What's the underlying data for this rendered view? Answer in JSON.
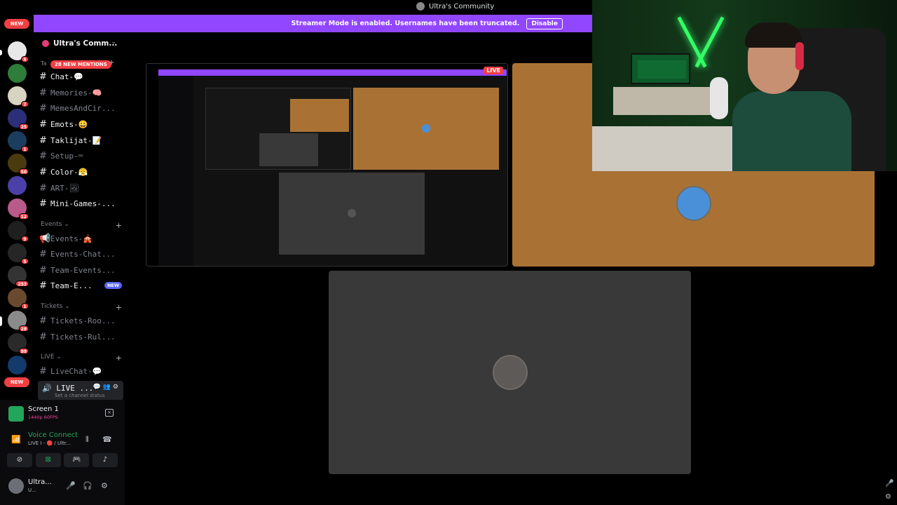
{
  "window": {
    "title": "Ultra's Community"
  },
  "banner": {
    "message": "Streamer Mode is enabled. Usernames have been truncated.",
    "disable_label": "Disable"
  },
  "rail": {
    "new_top": "NEW",
    "new_bottom": "NEW",
    "badges": [
      "5",
      "7",
      "25",
      "1",
      "50",
      "12",
      "9",
      "5",
      "253",
      "1",
      "28",
      "99"
    ]
  },
  "guild": {
    "name": "Ultra's Comm...",
    "mentions": "28 NEW MENTIONS",
    "category_peek": "Ta"
  },
  "channels": {
    "main": [
      {
        "name": "Chat-💬",
        "unread": true
      },
      {
        "name": "Memories-🧠",
        "unread": false
      },
      {
        "name": "MemesAndCir...",
        "unread": false
      },
      {
        "name": "Emots-😀",
        "unread": true
      },
      {
        "name": "Taklijat-📝",
        "unread": true
      },
      {
        "name": "Setup-⌨",
        "unread": false
      },
      {
        "name": "Color-😤",
        "unread": true
      },
      {
        "name": "ART-🖼",
        "unread": false
      },
      {
        "name": "Mini-Games-...",
        "unread": true
      }
    ],
    "events_category": "Events",
    "events": [
      {
        "name": "Events-🎪",
        "unread": false
      },
      {
        "name": "Events-Chat...",
        "unread": false
      },
      {
        "name": "Team-Events...",
        "unread": false
      },
      {
        "name": "Team-E...",
        "unread": true,
        "badge": "NEW"
      }
    ],
    "tickets_category": "Tickets",
    "tickets": [
      {
        "name": "Tickets-Roo...",
        "unread": false
      },
      {
        "name": "Tickets-Rul...",
        "unread": false
      }
    ],
    "live_category": "LIVE",
    "live": [
      {
        "name": "LiveChat-💬",
        "unread": false
      }
    ],
    "voice_channel": {
      "name": "LIVE ...",
      "status": "Set a channel status"
    }
  },
  "panel": {
    "screen_title": "Screen 1",
    "screen_sub": "1440p 60FPS",
    "voice_title": "Voice Connected",
    "voice_sub": "LIVE I - 🔴 / Ultr...",
    "user_name": "Ultra...",
    "user_sub": "U..."
  },
  "stage": {
    "live_label": "LIVE"
  },
  "colors": {
    "brand": "#9146ff",
    "danger": "#f23f43",
    "online": "#23a55a",
    "blurple": "#5865f2",
    "tile_orange": "#a97234",
    "tile_gray": "#3a3939"
  }
}
